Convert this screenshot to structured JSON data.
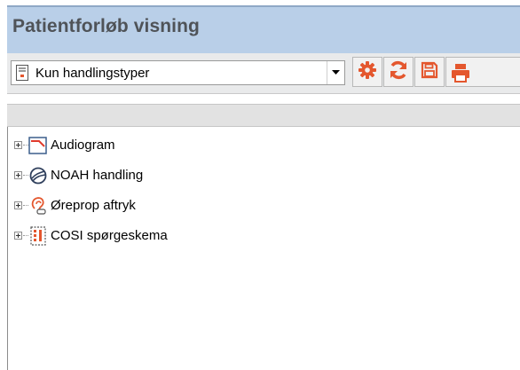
{
  "panel": {
    "title": "Patientforløb visning"
  },
  "toolbar": {
    "filter_select": {
      "value": "Kun handlingstyper",
      "icon": "document-list-icon"
    },
    "buttons": [
      {
        "name": "settings",
        "icon": "gear-icon"
      },
      {
        "name": "refresh",
        "icon": "refresh-icon"
      },
      {
        "name": "save",
        "icon": "floppy-disk-icon"
      },
      {
        "name": "print",
        "icon": "printer-icon"
      }
    ],
    "accent_color": "#e4572e"
  },
  "tree": {
    "items": [
      {
        "label": "Audiogram",
        "icon": "audiogram-icon"
      },
      {
        "label": "NOAH handling",
        "icon": "noah-icon"
      },
      {
        "label": "Øreprop aftryk",
        "icon": "ear-icon"
      },
      {
        "label": "COSI spørgeskema",
        "icon": "questionnaire-icon"
      }
    ]
  }
}
